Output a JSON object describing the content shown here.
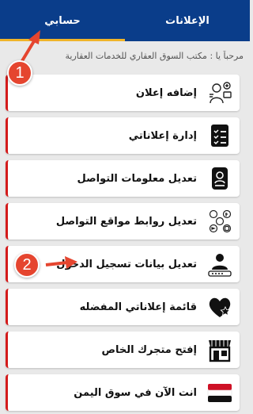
{
  "tabs": {
    "ads_label": "الإعلانات",
    "account_label": "حسابي"
  },
  "welcome_text": "مرحباً يا : مكتب السوق العقاري للخدمات العقارية",
  "menu": [
    {
      "label": "إضافه إعلان",
      "icon": "add-ad-icon"
    },
    {
      "label": "إدارة إعلاناتي",
      "icon": "checklist-icon"
    },
    {
      "label": "تعديل معلومات التواصل",
      "icon": "contact-card-icon"
    },
    {
      "label": "تعديل روابط مواقع التواصل",
      "icon": "social-links-icon"
    },
    {
      "label": "تعديل بيانات تسجيل الدخول",
      "icon": "login-user-icon"
    },
    {
      "label": "قائمة إعلاناتي المفضله",
      "icon": "heart-star-icon"
    },
    {
      "label": "إفتح متجرك الخاص",
      "icon": "store-icon"
    },
    {
      "label": "انت الآن في سوق اليمن",
      "icon": "yemen-flag-icon"
    }
  ],
  "annotations": [
    {
      "number": "1"
    },
    {
      "number": "2"
    }
  ],
  "colors": {
    "header": "#0a3d8a",
    "tab_underline": "#f0b429",
    "card_accent": "#d41b1b",
    "annotation": "#e5452f"
  }
}
